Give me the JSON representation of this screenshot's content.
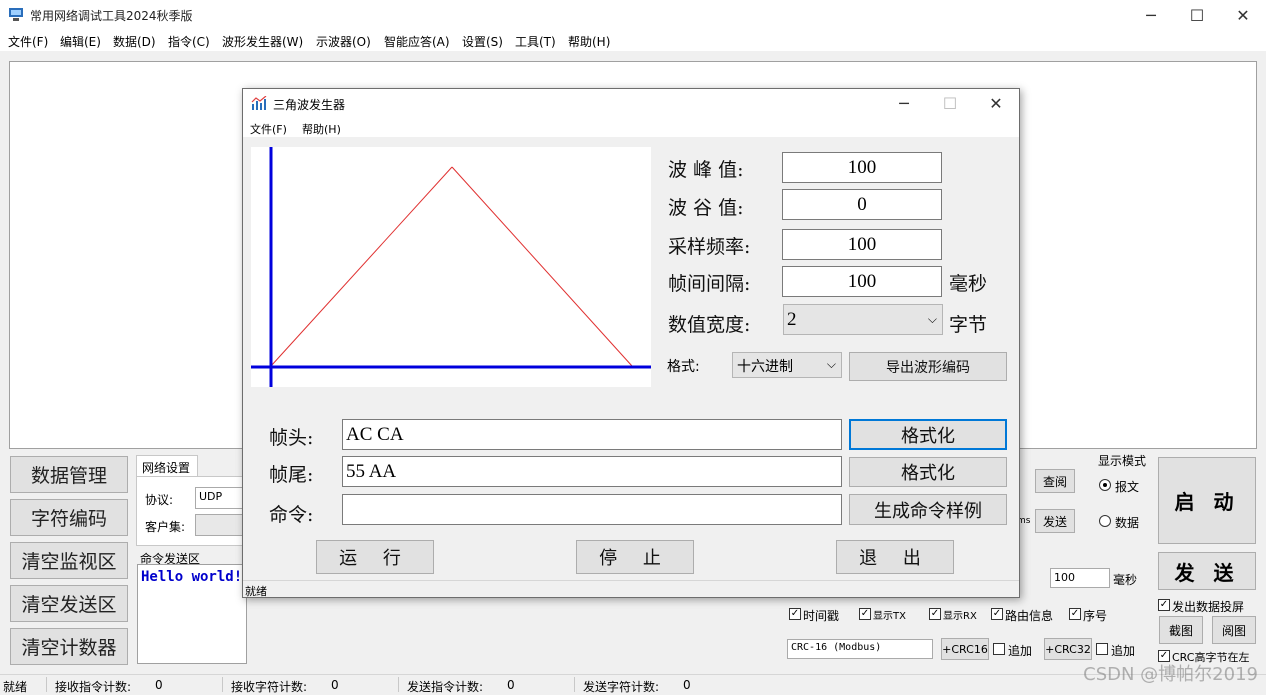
{
  "window": {
    "title": "常用网络调试工具2024秋季版",
    "min_icon": "─",
    "max_icon": "☐",
    "close_icon": "✕"
  },
  "menu": [
    "文件(F)",
    "编辑(E)",
    "数据(D)",
    "指令(C)",
    "波形发生器(W)",
    "示波器(O)",
    "智能应答(A)",
    "设置(S)",
    "工具(T)",
    "帮助(H)"
  ],
  "left_buttons": [
    "数据管理",
    "字符编码",
    "清空监视区",
    "清空发送区",
    "清空计数器"
  ],
  "net_tab": {
    "label": "网络设置",
    "protocol_label": "协议:",
    "protocol_value": "UDP",
    "client_label": "客户集:"
  },
  "cmd": {
    "group_label": "命令发送区",
    "text": "Hello world!"
  },
  "right_panel": {
    "query_btn": "查阅",
    "send_small_btn": "发送",
    "ms_fragment": "ms",
    "display_mode_label": "显示模式",
    "mode_message": "报文",
    "mode_data": "数据",
    "start_btn": "启 动",
    "send_btn": "发 送",
    "interval_value": "100",
    "interval_unit": "毫秒",
    "chk_timestamp": "时间戳",
    "chk_show_tx": "显示TX",
    "chk_show_rx": "显示RX",
    "chk_route": "路由信息",
    "chk_seq": "序号",
    "chk_screen": "发出数据投屏",
    "crc_select": "CRC-16 (Modbus)",
    "crc16_btn": "+CRC16",
    "append1": "追加",
    "crc32_btn": "+CRC32",
    "append2": "追加",
    "screenshot_btn": "截图",
    "view_btn": "阅图",
    "crc_high": "CRC高字节在左"
  },
  "status": {
    "ready": "就绪",
    "rx_cmd_label": "接收指令计数:",
    "rx_cmd": "0",
    "rx_char_label": "接收字符计数:",
    "rx_char": "0",
    "tx_cmd_label": "发送指令计数:",
    "tx_cmd": "0",
    "tx_char_label": "发送字符计数:",
    "tx_char": "0"
  },
  "dialog": {
    "title": "三角波发生器",
    "menu_file": "文件(F)",
    "menu_help": "帮助(H)",
    "peak_label": "波 峰 值:",
    "peak": "100",
    "valley_label": "波 谷 值:",
    "valley": "0",
    "rate_label": "采样频率:",
    "rate": "100",
    "frame_interval_label": "帧间间隔:",
    "frame_interval": "100",
    "frame_interval_unit": "毫秒",
    "width_label": "数值宽度:",
    "width": "2",
    "width_unit": "字节",
    "format_label": "格式:",
    "format": "十六进制",
    "export_btn": "导出波形编码",
    "head_label": "帧头:",
    "head": "AC CA",
    "tail_label": "帧尾:",
    "tail": "55 AA",
    "cmd_label": "命令:",
    "cmd": "",
    "format_btn1": "格式化",
    "format_btn2": "格式化",
    "gen_btn": "生成命令样例",
    "run_btn": "运 行",
    "stop_btn": "停 止",
    "exit_btn": "退 出",
    "status": "就绪",
    "waveform": {
      "shape": "triangle",
      "peak": 100,
      "valley": 0,
      "line_color": "#e03030",
      "axis_color": "#0000dd"
    }
  },
  "watermark": "CSDN @博帕尔2019"
}
